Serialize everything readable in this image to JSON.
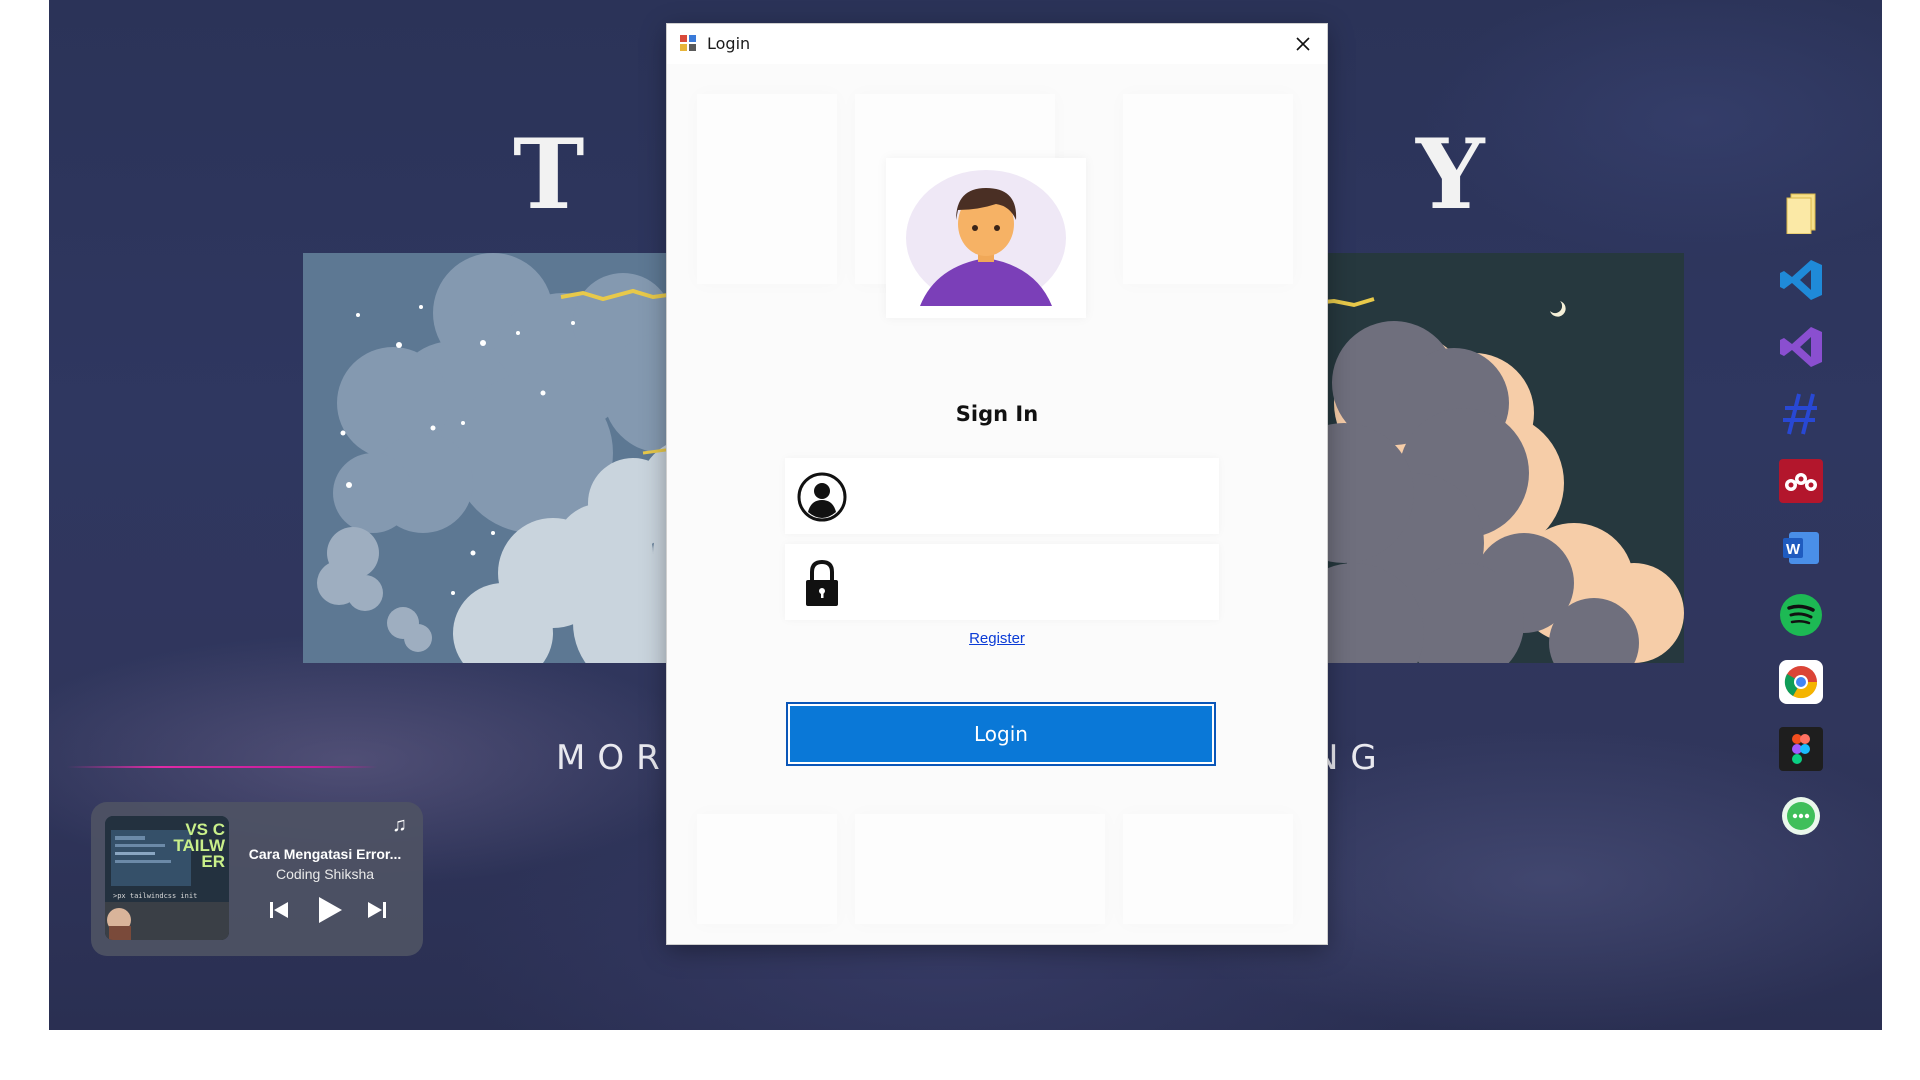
{
  "wallpaper": {
    "title_left": "T",
    "title_right": "Y",
    "subtitle_left": "MORN",
    "subtitle_right": "NG"
  },
  "media_player": {
    "thumbnail_text": "VS C\nTAILW\nER",
    "thumbnail_code": ">px tailwindcss init",
    "song_title": "Cara Mengatasi Error...",
    "artist": "Coding Shiksha",
    "controls": [
      "previous-icon",
      "play-icon",
      "next-icon"
    ],
    "music_icon": "music-note-icon"
  },
  "dock": {
    "items": [
      {
        "name": "file-explorer",
        "icon": "folder-icon",
        "color": "#f5d06a"
      },
      {
        "name": "visual-studio-code",
        "icon": "vscode-icon",
        "color": "#1f8ad8"
      },
      {
        "name": "visual-studio",
        "icon": "visual-studio-icon",
        "color": "#8a4fd0"
      },
      {
        "name": "hashtag-app",
        "icon": "hashtag-icon",
        "color": "#2b4fd0"
      },
      {
        "name": "mendeley",
        "icon": "mendeley-icon",
        "color": "#b3162c"
      },
      {
        "name": "microsoft-word",
        "icon": "word-icon",
        "color": "#2b6bd4"
      },
      {
        "name": "spotify",
        "icon": "spotify-icon",
        "color": "#1db954"
      },
      {
        "name": "google-chrome",
        "icon": "chrome-icon",
        "color": "#4285f4"
      },
      {
        "name": "figma",
        "icon": "figma-icon",
        "color": "#1e1e1e"
      },
      {
        "name": "messages",
        "icon": "chat-icon",
        "color": "#3fbf5a"
      }
    ]
  },
  "login_window": {
    "title": "Login",
    "heading": "Sign In",
    "username": {
      "value": "",
      "icon": "user-icon"
    },
    "password": {
      "value": "",
      "icon": "lock-icon"
    },
    "register_link": "Register",
    "login_button": "Login",
    "accent_color": "#0a78d7"
  }
}
